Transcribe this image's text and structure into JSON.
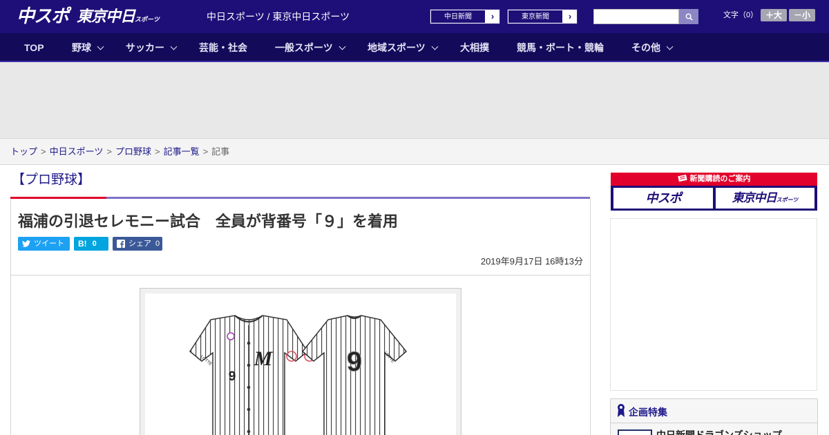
{
  "header": {
    "logo_main": "中スポ",
    "logo_tokyo": "東京中日",
    "logo_tokyo_small": "スポーツ",
    "site_names": "中日スポーツ / 東京中日スポーツ",
    "links": [
      {
        "label": "中日新聞"
      },
      {
        "label": "東京新聞"
      }
    ],
    "search": {
      "placeholder": ""
    },
    "font_size_label": "文字（0）",
    "font_buttons": [
      "＋大",
      "－小"
    ]
  },
  "nav": {
    "items": [
      {
        "label": "TOP",
        "has_dropdown": false
      },
      {
        "label": "野球",
        "has_dropdown": true
      },
      {
        "label": "サッカー",
        "has_dropdown": true
      },
      {
        "label": "芸能・社会",
        "has_dropdown": false
      },
      {
        "label": "一般スポーツ",
        "has_dropdown": true
      },
      {
        "label": "地域スポーツ",
        "has_dropdown": true
      },
      {
        "label": "大相撲",
        "has_dropdown": false
      },
      {
        "label": "競馬・ボート・競輪",
        "has_dropdown": false
      },
      {
        "label": "その他",
        "has_dropdown": true
      }
    ]
  },
  "breadcrumb": {
    "links": [
      "トップ",
      "中日スポーツ",
      "プロ野球",
      "記事一覧"
    ],
    "current": "記事",
    "separator": ">"
  },
  "article": {
    "category": "【プロ野球】",
    "headline": "福浦の引退セレモニー試合　全員が背番号「９」を着用",
    "share": {
      "tweet_label": "ツイート",
      "hatena_count": "0",
      "facebook_label": "シェア",
      "facebook_count": "0"
    },
    "date": "2019年9月17日 16時13分",
    "photo": {
      "front_number": "9",
      "back_number": "9",
      "front_logo": "M",
      "left_sleeve": "LOTTE",
      "right_sleeve": "LOTTE"
    }
  },
  "sidebar": {
    "subscription": {
      "heading": "新聞購読のご案内",
      "tiles": [
        "中スポ",
        "東京中日"
      ],
      "tile_small": "スポーツ"
    },
    "feature": {
      "title": "企画特集",
      "first_item": "中日新聞ドラゴンズショップ"
    }
  },
  "colors": {
    "header_bg": "#1e0f78",
    "nav_bg": "#130a5a",
    "accent_red": "#e2002c",
    "accent_purple": "#7d70c8",
    "link": "#1f1a8a",
    "share_twitter": "#1da1f2",
    "share_hatena": "#00a4de",
    "share_facebook": "#3b5998"
  }
}
